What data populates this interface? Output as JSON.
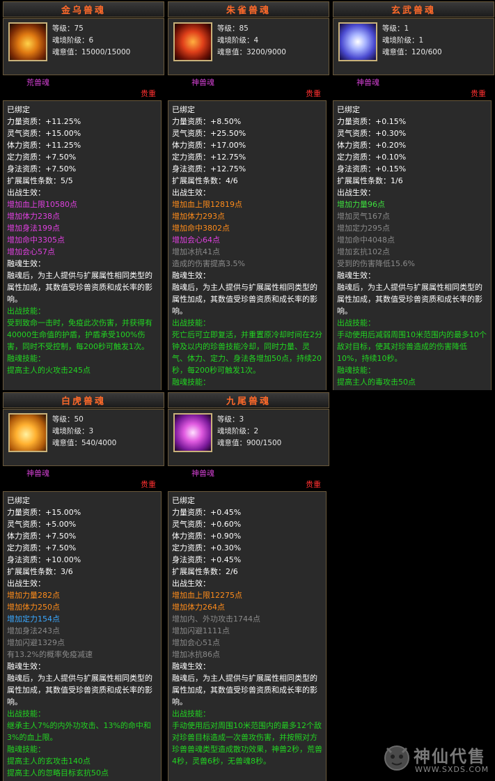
{
  "cards": [
    {
      "title": "金乌兽魂",
      "level": "等级：75",
      "stage": "魂境阶级：6",
      "soul": "魂意值：15000/15000",
      "type": "荒兽魂",
      "rarity": "贵重",
      "bound": "已绑定",
      "attrs": [
        "力量资质：+11.25%",
        "灵气资质：+15.00%",
        "体力资质：+11.25%",
        "定力资质：+7.50%",
        "身法资质：+7.50%"
      ],
      "ext_count": "扩展属性条数：5/5",
      "battle_label": "出战生效：",
      "battle_effects": [
        {
          "text": "增加血上限10580点",
          "color": "purple"
        },
        {
          "text": "增加体力238点",
          "color": "purple"
        },
        {
          "text": "增加身法199点",
          "color": "purple"
        },
        {
          "text": "增加命中3305点",
          "color": "purple"
        },
        {
          "text": "增加会心57点",
          "color": "purple"
        }
      ],
      "fuse_label": "融魂生效：",
      "fuse_desc": "融魂后，为主人提供与扩展属性相同类型的属性加成，其数值受珍兽资质和成长率的影响。",
      "skill_label": "出战技能：",
      "skill_desc": "受到致命一击时，免疫此次伤害，并获得有40000生命值的护盾，护盾承受100%伤害，同时不受控制，每200秒可触发1次。",
      "fuse_skill_label": "融魂技能：",
      "fuse_skill_desc": "提高主人的火攻击245点"
    },
    {
      "title": "朱雀兽魂",
      "level": "等级：85",
      "stage": "魂境阶级：4",
      "soul": "魂意值：3200/9000",
      "type": "神兽魂",
      "rarity": "贵重",
      "bound": "已绑定",
      "attrs": [
        "力量资质：+8.50%",
        "灵气资质：+25.50%",
        "体力资质：+17.00%",
        "定力资质：+12.75%",
        "身法资质：+12.75%"
      ],
      "ext_count": "扩展属性条数：4/6",
      "battle_label": "出战生效：",
      "battle_effects": [
        {
          "text": "增加血上限12819点",
          "color": "orange"
        },
        {
          "text": "增加体力293点",
          "color": "orange"
        },
        {
          "text": "增加命中3802点",
          "color": "orange"
        },
        {
          "text": "增加会心64点",
          "color": "purple"
        },
        {
          "text": "增加冰抗41点",
          "color": "gray"
        },
        {
          "text": "造成的伤害提高3.5%",
          "color": "gray"
        }
      ],
      "fuse_label": "融魂生效：",
      "fuse_desc": "融魂后，为主人提供与扩展属性相同类型的属性加成，其数值受珍兽资质和成长率的影响。",
      "skill_label": "出战技能：",
      "skill_desc": "死亡后可立即复活，并重置原冷却时间在2分钟及以内的珍兽技能冷却，同时力量、灵气、体力、定力、身法各增加50点，持续20秒，每200秒可触发1次。",
      "fuse_skill_label": "融魂技能：",
      "fuse_skill_desc": ""
    },
    {
      "title": "玄武兽魂",
      "level": "等级：1",
      "stage": "魂境阶级：1",
      "soul": "魂意值：120/600",
      "type": "神兽魂",
      "rarity": "贵重",
      "bound": "已绑定",
      "attrs": [
        "力量资质：+0.15%",
        "灵气资质：+0.30%",
        "体力资质：+0.20%",
        "定力资质：+0.10%",
        "身法资质：+0.15%"
      ],
      "ext_count": "扩展属性条数：1/6",
      "battle_label": "出战生效：",
      "battle_effects": [
        {
          "text": "增加力量96点",
          "color": "bgreen"
        },
        {
          "text": "增加灵气167点",
          "color": "gray"
        },
        {
          "text": "增加定力295点",
          "color": "gray"
        },
        {
          "text": "增加命中4048点",
          "color": "gray"
        },
        {
          "text": "增加玄抗102点",
          "color": "gray"
        },
        {
          "text": "受到的伤害降低15.6%",
          "color": "gray"
        }
      ],
      "fuse_label": "融魂生效：",
      "fuse_desc": "融魂后，为主人提供与扩展属性相同类型的属性加成，其数值受珍兽资质和成长率的影响。",
      "skill_label": "出战技能：",
      "skill_desc": "手动使用后减弱周围10米范围内的最多10个敌对目标，使其对珍兽造成的伤害降低10%，持续10秒。",
      "fuse_skill_label": "融魂技能：",
      "fuse_skill_desc": "提高主人的毒攻击50点"
    },
    {
      "title": "白虎兽魂",
      "level": "等级：50",
      "stage": "魂境阶级：3",
      "soul": "魂意值：540/4000",
      "type": "神兽魂",
      "rarity": "贵重",
      "bound": "已绑定",
      "attrs": [
        "力量资质：+15.00%",
        "灵气资质：+5.00%",
        "体力资质：+7.50%",
        "定力资质：+7.50%",
        "身法资质：+10.00%"
      ],
      "ext_count": "扩展属性条数：3/6",
      "battle_label": "出战生效：",
      "battle_effects": [
        {
          "text": "增加力量282点",
          "color": "orange"
        },
        {
          "text": "增加体力250点",
          "color": "orange"
        },
        {
          "text": "增加定力154点",
          "color": "blue"
        },
        {
          "text": "增加身法243点",
          "color": "gray"
        },
        {
          "text": "增加闪避1329点",
          "color": "gray"
        },
        {
          "text": "有13.2%的概率免疫减速",
          "color": "gray"
        }
      ],
      "fuse_label": "融魂生效：",
      "fuse_desc": "融魂后，为主人提供与扩展属性相同类型的属性加成，其数值受珍兽资质和成长率的影响。",
      "skill_label": "出战技能：",
      "skill_desc": "继承主人7%的内外功攻击、13%的命中和3%的血上限。",
      "fuse_skill_label": "融魂技能：",
      "fuse_skill_desc": "提高主人的玄攻击140点",
      "fuse_skill_desc2": "提高主人的忽略目标玄抗50点"
    },
    {
      "title": "九尾兽魂",
      "level": "等级：3",
      "stage": "魂境阶级：2",
      "soul": "魂意值：900/1500",
      "type": "神兽魂",
      "rarity": "贵重",
      "bound": "已绑定",
      "attrs": [
        "力量资质：+0.45%",
        "灵气资质：+0.60%",
        "体力资质：+0.90%",
        "定力资质：+0.30%",
        "身法资质：+0.45%"
      ],
      "ext_count": "扩展属性条数：2/6",
      "battle_label": "出战生效：",
      "battle_effects": [
        {
          "text": "增加血上限12275点",
          "color": "orange"
        },
        {
          "text": "增加体力264点",
          "color": "orange"
        },
        {
          "text": "增加内、外功攻击1744点",
          "color": "gray"
        },
        {
          "text": "增加闪避1111点",
          "color": "gray"
        },
        {
          "text": "增加会心51点",
          "color": "gray"
        },
        {
          "text": "增加冰抗86点",
          "color": "gray"
        }
      ],
      "fuse_label": "融魂生效：",
      "fuse_desc": "融魂后，为主人提供与扩展属性相同类型的属性加成，其数值受珍兽资质和成长率的影响。",
      "skill_label": "出战技能：",
      "skill_desc": "手动使用后对周围10米范围内的最多12个敌对珍兽目标造成一次兽攻伤害，并按照对方珍兽兽魂类型造成散功效果，神兽2秒，荒兽4秒，灵兽6秒，无兽魂8秒。",
      "fuse_skill_label": "",
      "fuse_skill_desc": ""
    }
  ],
  "watermark": {
    "name": "神仙代售",
    "url": "WWW.SXDS.COM"
  },
  "colors": {
    "title": "#ff6a2a",
    "rarity": "#ff3030",
    "green": "#22d422",
    "orange": "#ff8c1a",
    "purple": "#e040e0",
    "blue": "#3aa8ff",
    "gray": "#8a8a8a"
  }
}
